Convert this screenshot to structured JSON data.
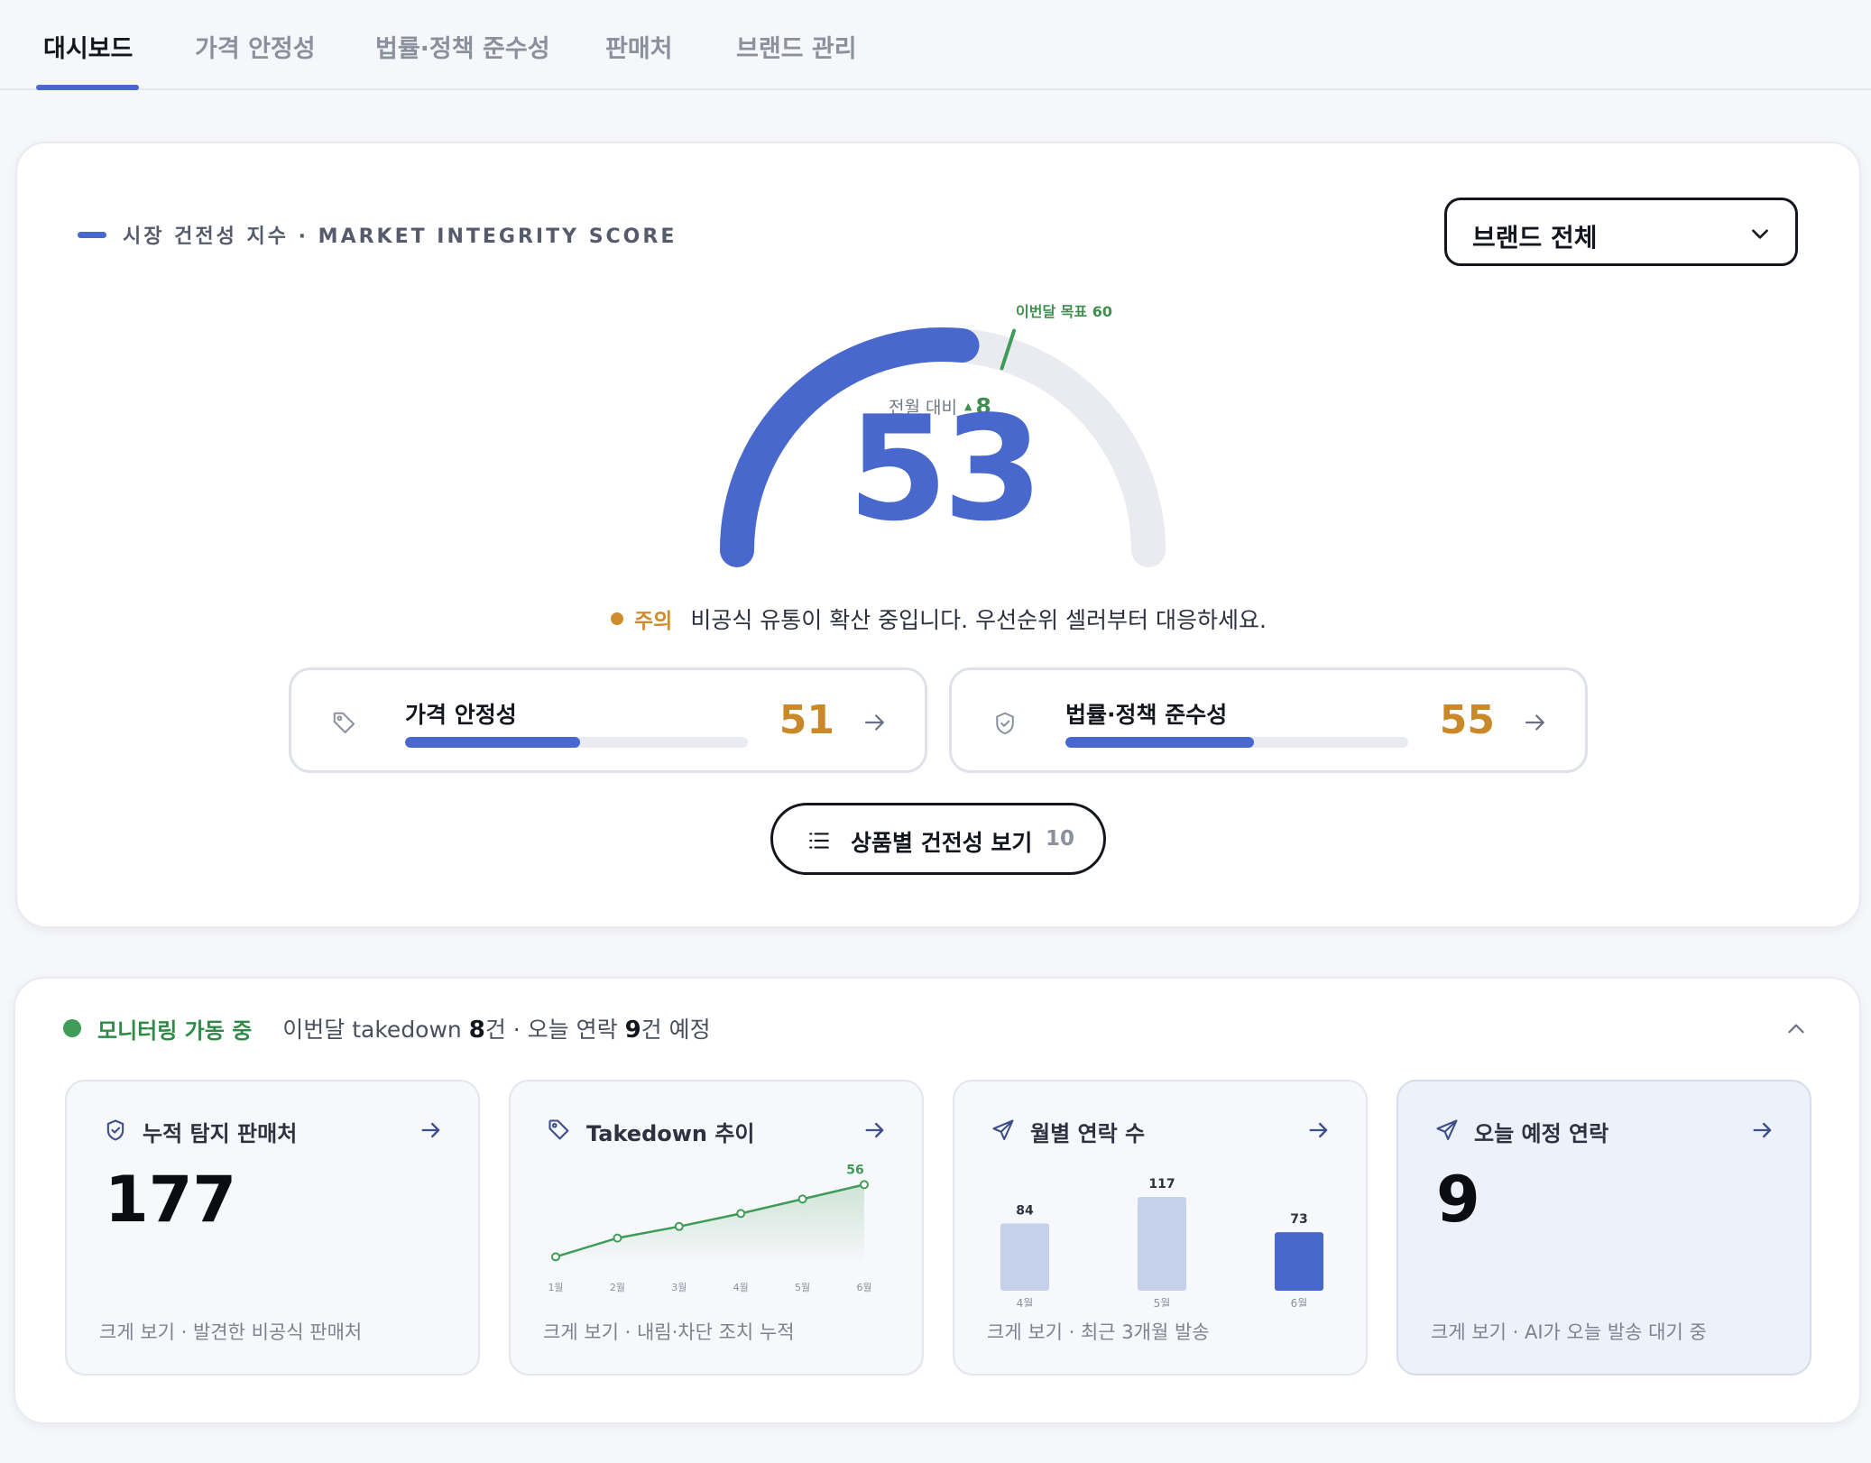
{
  "tabs": [
    {
      "label": "대시보드",
      "active": true
    },
    {
      "label": "가격 안정성",
      "active": false
    },
    {
      "label": "법률·정책 준수성",
      "active": false
    },
    {
      "label": "판매처",
      "active": false
    },
    {
      "label": "브랜드 관리",
      "active": false
    }
  ],
  "integrity": {
    "section_label": "시장 건전성 지수 · MARKET INTEGRITY SCORE",
    "brand_select": {
      "selected": "브랜드 전체"
    },
    "score": 53,
    "score_max": 100,
    "target": 60,
    "target_label": "이번달 목표 60",
    "delta_label": "전월 대비",
    "delta_value": "8",
    "status_tag": "주의",
    "status_message": "비공식 유통이 확산 중입니다. 우선순위 셀러부터 대응하세요.",
    "metrics": [
      {
        "title": "가격 안정성",
        "value": 51,
        "icon": "tag-icon"
      },
      {
        "title": "법률·정책 준수성",
        "value": 55,
        "icon": "shield-icon"
      }
    ],
    "product_button": {
      "label": "상품별 건전성 보기",
      "count": "10"
    }
  },
  "monitoring": {
    "status": "모니터링 가동 중",
    "summary_prefix": "이번달 takedown ",
    "summary_takedown": "8",
    "summary_mid": "건 · 오늘 연락 ",
    "summary_contacts": "9",
    "summary_suffix": "건 예정",
    "tiles": [
      {
        "title": "누적 탐지 판매처",
        "value": "177",
        "footer": "크게 보기 · 발견한 비공식 판매처",
        "icon": "shield-check-icon"
      },
      {
        "title": "Takedown 추이",
        "footer": "크게 보기 · 내림·차단 조치 누적",
        "icon": "tag-icon"
      },
      {
        "title": "월별 연락 수",
        "footer": "크게 보기 · 최근 3개월 발송",
        "icon": "send-icon"
      },
      {
        "title": "오늘 예정 연락",
        "value": "9",
        "footer": "크게 보기 · AI가 오늘 발송 대기 중",
        "icon": "send-icon"
      }
    ]
  },
  "chart_data": [
    {
      "type": "line",
      "title": "Takedown 추이",
      "categories": [
        "1월",
        "2월",
        "3월",
        "4월",
        "5월",
        "6월"
      ],
      "values": [
        6,
        19,
        27,
        36,
        46,
        56
      ],
      "data_labels": [
        "",
        "",
        "",
        "",
        "",
        "56"
      ],
      "ylim": [
        0,
        60
      ],
      "grid": false,
      "color": "#3f9c58"
    },
    {
      "type": "bar",
      "title": "월별 연락 수",
      "categories": [
        "4월",
        "5월",
        "6월"
      ],
      "values": [
        84,
        117,
        73
      ],
      "ylim": [
        0,
        117
      ],
      "grid": false,
      "colors": [
        "#c6d1ec",
        "#c6d1ec",
        "#4868ce"
      ]
    }
  ],
  "colors": {
    "accent": "#4868ce",
    "warning": "#c9892a",
    "success": "#3f9c58",
    "track": "#e9ebf1"
  }
}
